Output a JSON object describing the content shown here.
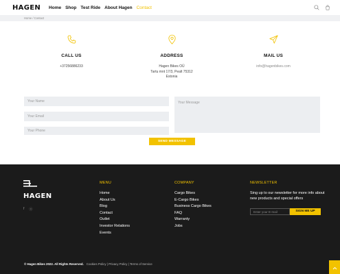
{
  "brand": {
    "name": "HAGEN",
    "accent": "#f2c200"
  },
  "nav": {
    "items": [
      {
        "label": "Home"
      },
      {
        "label": "Shop"
      },
      {
        "label": "Test Ride"
      },
      {
        "label": "About Hagen"
      },
      {
        "label": "Contact"
      }
    ]
  },
  "breadcrumb": "Home / Contact",
  "contact": {
    "call": {
      "title": "CALL US",
      "value": "+37256886233"
    },
    "address": {
      "title": "ADDRESS",
      "line1": "Hagen Bikes OÜ",
      "line2": "Tartu mnt 17/3, Pealt 75312",
      "line3": "Estonia"
    },
    "mail": {
      "title": "MAIL US",
      "value": "info@hagenbikes.com"
    }
  },
  "form": {
    "name_placeholder": "Your Name",
    "email_placeholder": "Your Email",
    "phone_placeholder": "Your Phone",
    "message_placeholder": "Your Message",
    "send_label": "SEND MESSAGE"
  },
  "footer": {
    "logo_text": "HAGEN",
    "social": [
      "f",
      "ⓞ"
    ],
    "menu": {
      "title": "MENU",
      "items": [
        "Home",
        "About Us",
        "Blog",
        "Contact",
        "Outlet",
        "Investor Relations",
        "Events"
      ]
    },
    "company": {
      "title": "COMPANY",
      "items": [
        "Cargo Bikes",
        "E-Cargo Bikes",
        "Business Cargo Bikes",
        "FAQ",
        "Warranty",
        "Jobs"
      ]
    },
    "newsletter": {
      "title": "NEWSLETTER",
      "text": "Sing up to our newsletter for more info about new products and special offers",
      "input_placeholder": "Enter your E-mail",
      "button_label": "SIGN ME UP"
    },
    "copyright": "© Hagen Bikes 2022. All Rights Reserved.",
    "legal_links": "Cookies Policy | Privacy Policy | Terms of Service"
  }
}
